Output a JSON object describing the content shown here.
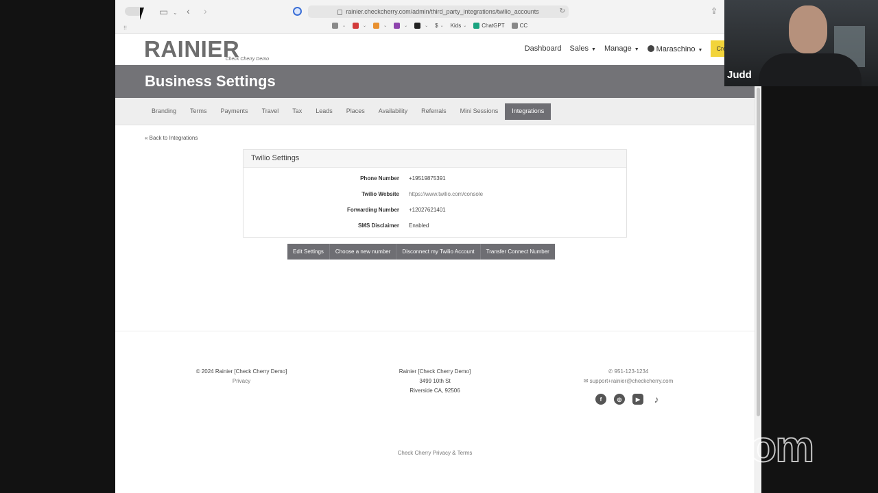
{
  "browser": {
    "url": "rainier.checkcherry.com/admin/third_party_integrations/twilio_accounts",
    "bookmarks": [
      {
        "label": "",
        "color": "#8a8a8a"
      },
      {
        "label": "",
        "color": "#d23a3a"
      },
      {
        "label": "",
        "color": "#e89030"
      },
      {
        "label": "",
        "color": "#8e44ad"
      },
      {
        "label": "",
        "color": "#222222"
      },
      {
        "label": "$",
        "color": ""
      },
      {
        "label": "Kids",
        "color": ""
      },
      {
        "label": "ChatGPT",
        "color": "#19a37f"
      },
      {
        "label": "CC",
        "color": "#888888"
      }
    ]
  },
  "site": {
    "logo_word": "RAINIER",
    "logo_sub": "Check Cherry Demo",
    "nav": {
      "dashboard": "Dashboard",
      "sales": "Sales",
      "manage": "Manage",
      "user": "Maraschino",
      "create_new": "Create New"
    },
    "page_title": "Business Settings",
    "tabs": [
      "Branding",
      "Terms",
      "Payments",
      "Travel",
      "Tax",
      "Leads",
      "Places",
      "Availability",
      "Referrals",
      "Mini Sessions",
      "Integrations"
    ],
    "active_tab": "Integrations",
    "back_link": "« Back to Integrations",
    "card": {
      "title": "Twilio Settings",
      "rows": [
        {
          "label": "Phone Number",
          "value": "+19519875391"
        },
        {
          "label": "Twilio Website",
          "value": "https://www.twilio.com/console"
        },
        {
          "label": "Forwarding Number",
          "value": "+12027621401"
        },
        {
          "label": "SMS Disclaimer",
          "value": "Enabled"
        }
      ]
    },
    "actions": {
      "edit": "Edit Settings",
      "choose": "Choose a new number",
      "disconnect": "Disconnect my Twilio Account",
      "transfer": "Transfer Connect Number"
    },
    "footer": {
      "copyright": "© 2024 Rainier [Check Cherry Demo]",
      "privacy": "Privacy",
      "company": "Rainier [Check Cherry Demo]",
      "street": "3499 10th St",
      "city": "Riverside CA, 92506",
      "phone": "951-123-1234",
      "email": "support+rainier@checkcherry.com",
      "bottom": "Check Cherry Privacy & Terms"
    }
  },
  "zoom": {
    "participant": "Judd",
    "watermark": "zoom"
  }
}
